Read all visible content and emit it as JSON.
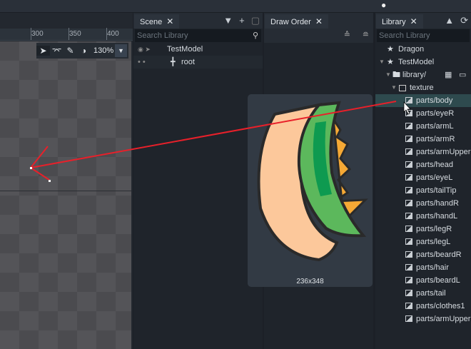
{
  "canvas": {
    "ruler_ticks": [
      "300",
      "350",
      "400"
    ],
    "zoom_level": "130%"
  },
  "scene": {
    "tab_label": "Scene",
    "search_placeholder": "Search Library",
    "tree": [
      {
        "label": "TestModel"
      },
      {
        "label": "root"
      }
    ]
  },
  "draw_order": {
    "tab_label": "Draw Order"
  },
  "library": {
    "tab_label": "Library",
    "search_placeholder": "Search Library",
    "items": [
      {
        "label": "Dragon"
      },
      {
        "label": "TestModel"
      },
      {
        "label": "library/"
      },
      {
        "label": "texture"
      }
    ],
    "textures": [
      "parts/body",
      "parts/eyeR",
      "parts/armL",
      "parts/armR",
      "parts/armUpperR",
      "parts/head",
      "parts/eyeL",
      "parts/tailTip",
      "parts/handR",
      "parts/handL",
      "parts/legR",
      "parts/legL",
      "parts/beardR",
      "parts/hair",
      "parts/beardL",
      "parts/tail",
      "parts/clothes1",
      "parts/armUpperL"
    ],
    "selected": "parts/body"
  },
  "preview": {
    "size_label": "236x348"
  },
  "colors": {
    "selection": "#2e4a4e",
    "arrow": "#e8202a"
  }
}
